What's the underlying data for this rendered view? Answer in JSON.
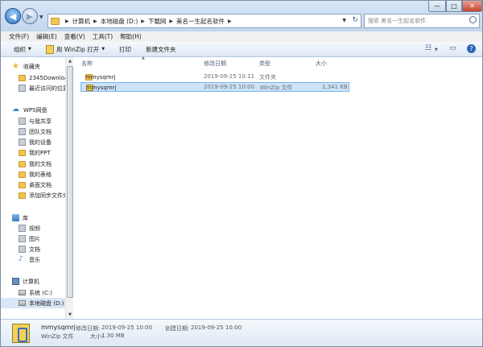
{
  "window": {
    "minimize_glyph": "—",
    "maximize_glyph": "□",
    "close_glyph": "✕"
  },
  "address": {
    "crumbs": [
      "计算机",
      "本地磁盘 (D:)",
      "下载网",
      "美名一生起名软件"
    ],
    "search_placeholder": "搜索 美名一生起名软件"
  },
  "menu": [
    "文件(F)",
    "编辑(E)",
    "查看(V)",
    "工具(T)",
    "帮助(H)"
  ],
  "toolbar": {
    "organize": "组织",
    "open_with": "用 WinZip 打开",
    "print": "打印",
    "new_folder": "新建文件夹"
  },
  "sidebar": [
    {
      "label": "收藏夹",
      "icon": "star-icon"
    },
    {
      "label": "2345Downloa",
      "icon": "folder-icon"
    },
    {
      "label": "最近访问的位置",
      "icon": "recent-icon"
    },
    {
      "label": "WPS网盘",
      "icon": "cloud-icon"
    },
    {
      "label": "与我共享",
      "icon": "share-icon"
    },
    {
      "label": "团队文档",
      "icon": "team-icon"
    },
    {
      "label": "我的设备",
      "icon": "device-icon"
    },
    {
      "label": "我的PPT",
      "icon": "folder-icon"
    },
    {
      "label": "我的文档",
      "icon": "folder-icon"
    },
    {
      "label": "我的表格",
      "icon": "folder-icon"
    },
    {
      "label": "桌面文档",
      "icon": "folder-icon"
    },
    {
      "label": "添加同步文件夹",
      "icon": "folder-icon"
    },
    {
      "label": "库",
      "icon": "library-icon"
    },
    {
      "label": "视频",
      "icon": "video-icon"
    },
    {
      "label": "图片",
      "icon": "picture-icon"
    },
    {
      "label": "文档",
      "icon": "document-icon"
    },
    {
      "label": "音乐",
      "icon": "music-icon"
    },
    {
      "label": "计算机",
      "icon": "computer-icon"
    },
    {
      "label": "系统 (C:)",
      "icon": "drive-icon"
    },
    {
      "label": "本地磁盘 (D:)",
      "icon": "drive-icon"
    }
  ],
  "columns": {
    "name": "名称",
    "date": "修改日期",
    "type": "类型",
    "size": "大小"
  },
  "files": [
    {
      "name": "mmysqmrj",
      "date": "2019-09-25 10:11",
      "type": "文件夹",
      "size": "",
      "icon": "folder-icon"
    },
    {
      "name": "mmysqmrj",
      "date": "2019-09-25 10:00",
      "type": "WinZip 文件",
      "size": "1,341 KB",
      "icon": "winzip-icon"
    }
  ],
  "status": {
    "name": "mmysqmrj",
    "modified_label": "修改日期:",
    "modified_value": "2019-09-25 10:00",
    "created_label": "创建日期:",
    "created_value": "2019-09-25 10:00",
    "type": "WinZip 文件",
    "size_label": "大小:",
    "size_value": "1.30 MB"
  }
}
